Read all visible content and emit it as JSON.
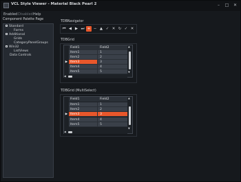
{
  "window": {
    "title": "VCL Style Viewer - Material Black Pearl 2",
    "minimize_glyph": "–",
    "maximize_glyph": "□",
    "close_glyph": "✕"
  },
  "menu": {
    "items": [
      {
        "label": "Enabled",
        "disabled": false
      },
      {
        "label": "Disabled",
        "disabled": true
      },
      {
        "label": "Help",
        "disabled": false
      }
    ]
  },
  "palette": {
    "caption": "Component Palette Page",
    "tree": [
      {
        "label": "Standard",
        "level": 0,
        "box": true
      },
      {
        "label": "Forms",
        "level": 1,
        "box": false
      },
      {
        "label": "Additional",
        "level": 0,
        "box": true
      },
      {
        "label": "Grids",
        "level": 1,
        "box": false
      },
      {
        "label": "CategoryPanelGroups",
        "level": 1,
        "box": false
      },
      {
        "label": "Win32",
        "level": 0,
        "box": true
      },
      {
        "label": "ListViews",
        "level": 1,
        "box": false
      },
      {
        "label": "Data Controls",
        "level": 0,
        "box": false
      }
    ]
  },
  "navigator": {
    "label": "TDBNavigator",
    "buttons": [
      {
        "name": "first",
        "glyph": "⏮"
      },
      {
        "name": "prior",
        "glyph": "◀"
      },
      {
        "name": "next",
        "glyph": "▶"
      },
      {
        "name": "last",
        "glyph": "⏭"
      },
      {
        "name": "insert",
        "glyph": "+",
        "active": true
      },
      {
        "name": "delete",
        "glyph": "−"
      },
      {
        "name": "edit",
        "glyph": "▲"
      },
      {
        "name": "post",
        "glyph": "✓"
      },
      {
        "name": "cancel",
        "glyph": "✕"
      },
      {
        "name": "refresh",
        "glyph": "↻"
      },
      {
        "name": "apply-updates",
        "glyph": "✓"
      },
      {
        "name": "cancel-updates",
        "glyph": "✕"
      }
    ]
  },
  "grid1": {
    "label": "TDBGrid",
    "columns": [
      "Field1",
      "Field2"
    ],
    "rows": [
      {
        "field1": "Item1",
        "field2": "1"
      },
      {
        "field1": "Item2",
        "field2": "2"
      },
      {
        "field1": "Item3",
        "field2": "3",
        "selected": true
      },
      {
        "field1": "Item4",
        "field2": "4"
      },
      {
        "field1": "Item5",
        "field2": "5"
      }
    ],
    "indicator_glyph": "▶"
  },
  "grid2": {
    "label": "TDBGrid (MultiSelect)",
    "columns": [
      "Field1",
      "Field2"
    ],
    "rows": [
      {
        "field1": "Item1",
        "field2": "1"
      },
      {
        "field1": "Item2",
        "field2": "2"
      },
      {
        "field1": "Item3",
        "field2": "3",
        "selected": true
      },
      {
        "field1": "Item4",
        "field2": "4"
      },
      {
        "field1": "Item5",
        "field2": "5"
      }
    ],
    "indicator_glyph": "▶"
  },
  "colors": {
    "accent": "#e8572b",
    "window_bg": "#16191d",
    "panel_bg": "#252a31"
  }
}
